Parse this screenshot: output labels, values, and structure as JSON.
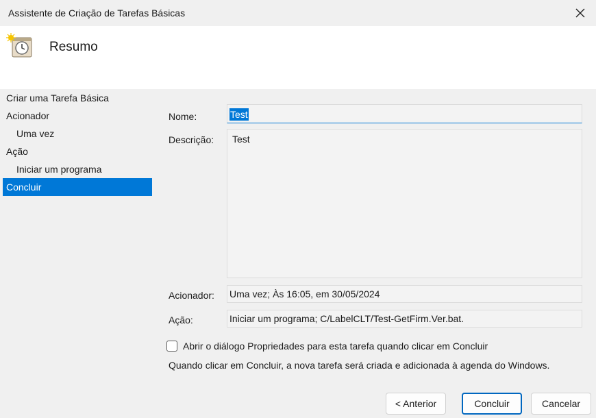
{
  "window": {
    "title": "Assistente de Criação de Tarefas Básicas"
  },
  "header": {
    "heading": "Resumo",
    "icon": "task-scheduler-clock-icon"
  },
  "steps": [
    {
      "label": "Criar uma Tarefa Básica",
      "level": 0,
      "active": false
    },
    {
      "label": "Acionador",
      "level": 0,
      "active": false
    },
    {
      "label": "Uma vez",
      "level": 1,
      "active": false
    },
    {
      "label": "Ação",
      "level": 0,
      "active": false
    },
    {
      "label": "Iniciar um programa",
      "level": 1,
      "active": false
    },
    {
      "label": "Concluir",
      "level": 0,
      "active": true
    }
  ],
  "summary": {
    "name_label": "Nome:",
    "name_value": "Test",
    "description_label": "Descrição:",
    "description_value": "Test",
    "trigger_label": "Acionador:",
    "trigger_value": "Uma vez; Às 16:05, em 30/05/2024",
    "action_label": "Ação:",
    "action_value": "Iniciar um programa; C/LabelCLT/Test-GetFirm.Ver.bat."
  },
  "options": {
    "open_properties_label": "Abrir o diálogo Propriedades para esta tarefa quando clicar em Concluir",
    "open_properties_checked": false,
    "info_text": "Quando clicar em Concluir, a nova tarefa será criada e adicionada à agenda do Windows."
  },
  "buttons": {
    "back": "< Anterior",
    "finish": "Concluir",
    "cancel": "Cancelar"
  },
  "colors": {
    "accent": "#0078d7",
    "background": "#f0f0f0",
    "header_background": "#ffffff"
  }
}
